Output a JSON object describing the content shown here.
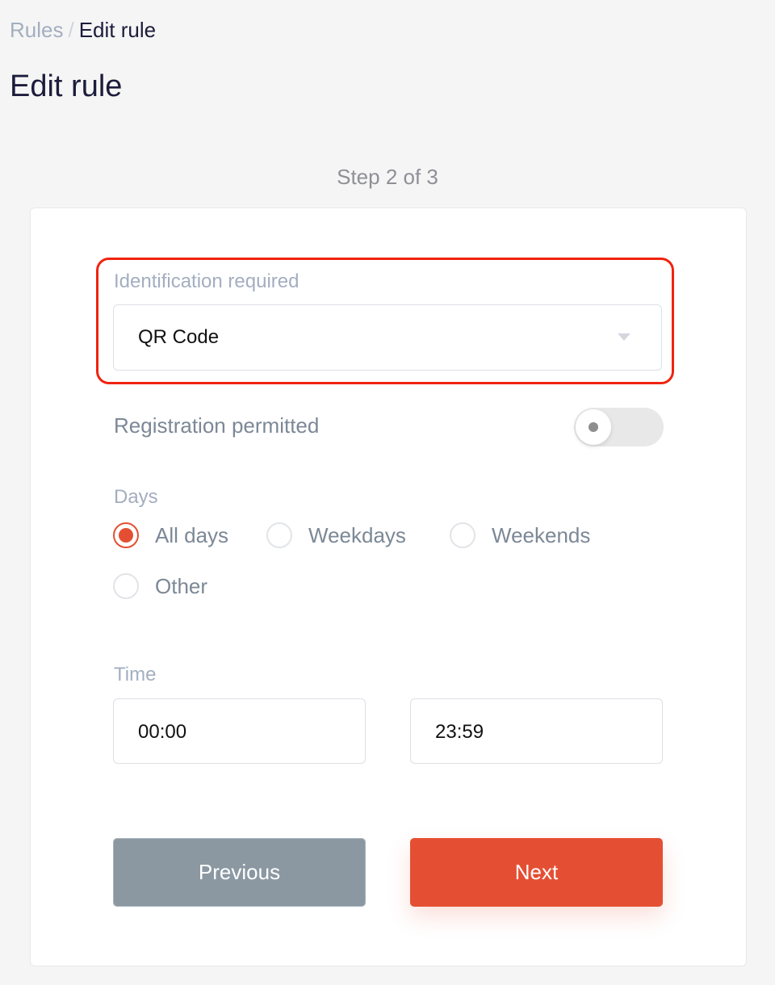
{
  "breadcrumb": {
    "root": "Rules",
    "separator": "/",
    "current": "Edit rule"
  },
  "page_title": "Edit rule",
  "step_indicator": "Step 2 of 3",
  "form": {
    "identification": {
      "label": "Identification required",
      "value": "QR Code",
      "icon": "caret-down-icon"
    },
    "registration": {
      "label": "Registration permitted",
      "enabled": false
    },
    "days": {
      "label": "Days",
      "options": [
        {
          "label": "All days",
          "checked": true
        },
        {
          "label": "Weekdays",
          "checked": false
        },
        {
          "label": "Weekends",
          "checked": false
        },
        {
          "label": "Other",
          "checked": false
        }
      ]
    },
    "time": {
      "label": "Time",
      "start": "00:00",
      "end": "23:59"
    }
  },
  "buttons": {
    "previous": "Previous",
    "next": "Next"
  },
  "colors": {
    "accent": "#e44f33",
    "highlight": "#f0230f",
    "secondary_button": "#8b98a2"
  }
}
